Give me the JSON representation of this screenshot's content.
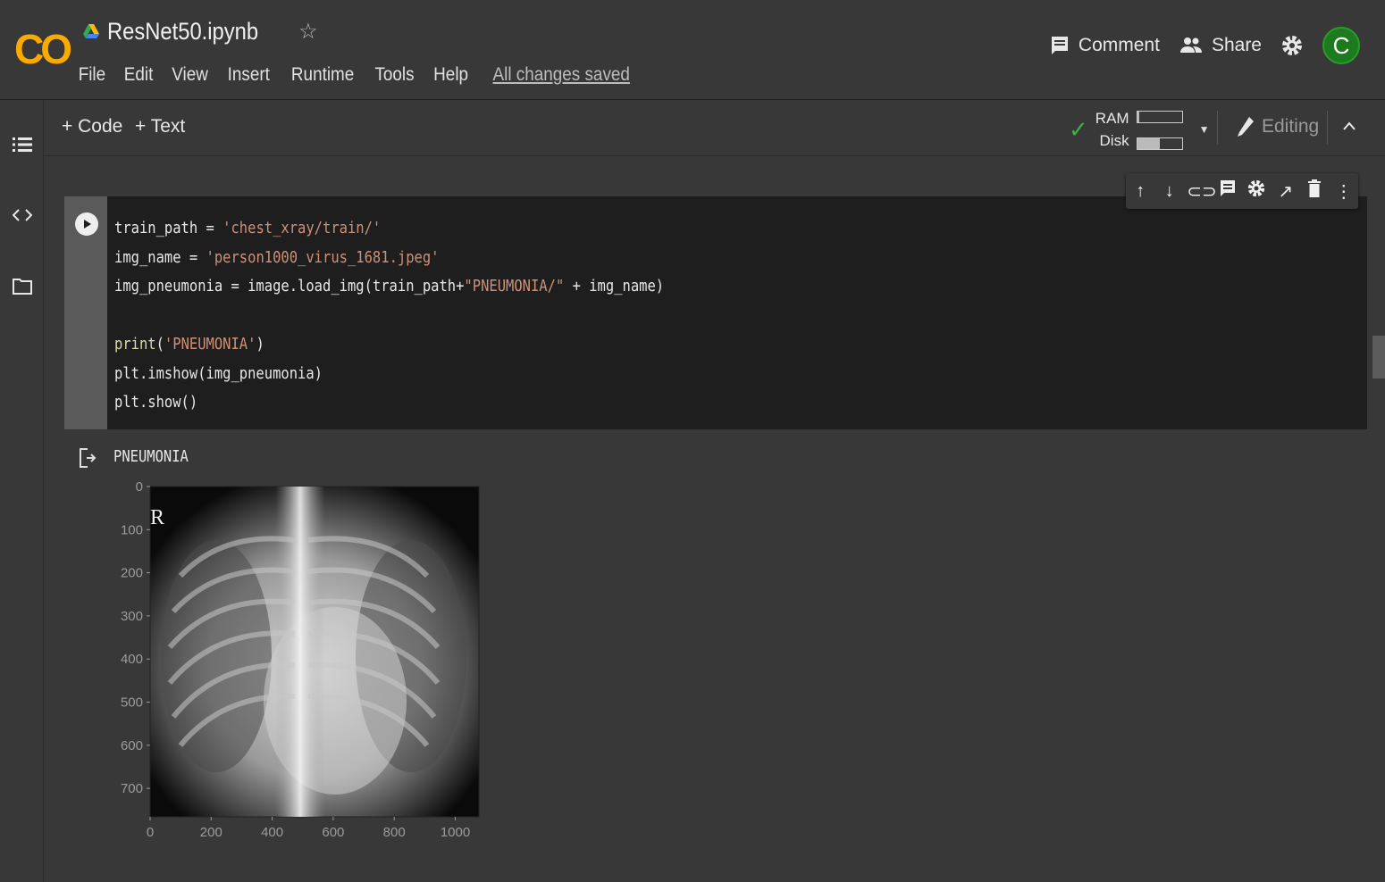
{
  "header": {
    "logo": "CO",
    "doc_title": "ResNet50.ipynb",
    "menu": [
      "File",
      "Edit",
      "View",
      "Insert",
      "Runtime",
      "Tools",
      "Help"
    ],
    "save_status": "All changes saved",
    "comment_label": "Comment",
    "share_label": "Share",
    "avatar_initial": "C"
  },
  "toolbar": {
    "add_code": "+ Code",
    "add_text": "+ Text",
    "ram_label": "RAM",
    "disk_label": "Disk",
    "ram_usage": 0.05,
    "disk_usage": 0.5,
    "editing_label": "Editing"
  },
  "cell": {
    "code": [
      {
        "segments": [
          {
            "t": "train_path = "
          },
          {
            "t": "'chest_xray/train/'",
            "c": "str"
          }
        ]
      },
      {
        "segments": [
          {
            "t": "img_name = "
          },
          {
            "t": "'person1000_virus_1681.jpeg'",
            "c": "str"
          }
        ]
      },
      {
        "segments": [
          {
            "t": "img_pneumonia = image.load_img(train_path+"
          },
          {
            "t": "\"PNEUMONIA/\"",
            "c": "str"
          },
          {
            "t": " + img_name)"
          }
        ]
      },
      {
        "segments": [
          {
            "t": ""
          }
        ]
      },
      {
        "segments": [
          {
            "t": "print",
            "c": "fn"
          },
          {
            "t": "("
          },
          {
            "t": "'PNEUMONIA'",
            "c": "str"
          },
          {
            "t": ")"
          }
        ]
      },
      {
        "segments": [
          {
            "t": "plt.imshow(img_pneumonia)"
          }
        ]
      },
      {
        "segments": [
          {
            "t": "plt.show()"
          }
        ]
      }
    ],
    "output_text": "PNEUMONIA",
    "plot": {
      "image_marker": "R",
      "y_ticks": [
        "0",
        "100",
        "200",
        "300",
        "400",
        "500",
        "600",
        "700"
      ],
      "x_ticks": [
        "0",
        "200",
        "400",
        "600",
        "800",
        "1000"
      ]
    }
  },
  "colors": {
    "accent": "#f9ab00",
    "avatar": "#1e7a1e",
    "check": "#3cb043",
    "string": "#ce9178"
  }
}
